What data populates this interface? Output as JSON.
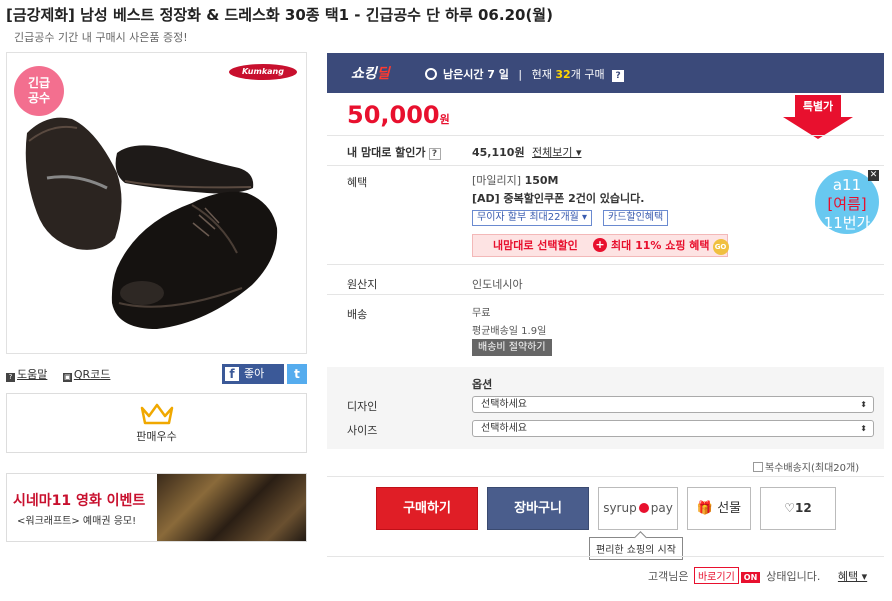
{
  "header": {
    "title": "[금강제화] 남성 베스트 정장화 & 드레스화 30종 택1 - 긴급공수 단 하루 06.20(월)",
    "subtitle": "긴급공수 기간 내 구매시 사은품 증정!"
  },
  "left": {
    "badge": [
      "긴급",
      "공수"
    ],
    "brand": "Kumkang",
    "help_link": "도움말",
    "qr_link": "QR코드",
    "facebook_label": "좋아",
    "facebook_f": "f",
    "twitter_label": "t",
    "seller_label": "판매우수",
    "banner": {
      "title": "시네마11 영화 이벤트",
      "subtitle": "<워크래프트> 예매권 응모!"
    }
  },
  "deal": {
    "logo_main": "쇼킹",
    "logo_accent": "딜",
    "time_label": "남은시간 7 일",
    "count_prefix": "현재",
    "count_value": "32",
    "count_suffix": "개 구매",
    "help": "?"
  },
  "price": {
    "amount": "50,000",
    "unit": "원",
    "special_label": "특별가"
  },
  "my_price": {
    "label": "내 맘대로 할인가",
    "help": "?",
    "value": "45,110원",
    "view_all": "전체보기 ▾"
  },
  "benefit": {
    "label": "혜택",
    "mileage_prefix": "[마일리지]",
    "mileage_value": "150M",
    "coupon": "[AD] 중복할인쿠폰 2건이 있습니다.",
    "chip_installment": "무이자 할부 최대22개월 ▾",
    "chip_card": "카드할인혜택",
    "discount_left": "내맘대로 선택할인",
    "discount_plus": "+",
    "discount_right": "최대 11% 쇼핑 혜택",
    "discount_go": "GO",
    "promo": [
      "a11",
      "[여름]",
      "11번가"
    ],
    "promo_close": "✕"
  },
  "origin": {
    "label": "원산지",
    "value": "인도네시아"
  },
  "shipping": {
    "label": "배송",
    "fee": "무료",
    "avg_days": "평균배송일 1.9일",
    "save_button": "배송비 절약하기"
  },
  "options": {
    "title": "옵션",
    "design_label": "디자인",
    "design_value": "선택하세요",
    "size_label": "사이즈",
    "size_value": "선택하세요",
    "arrow": "⬍"
  },
  "multi_ship": "복수배송지(최대20개)",
  "buttons": {
    "buy": "구매하기",
    "cart": "장바구니",
    "syrup_left": "syrup",
    "syrup_right": "pay",
    "gift": "선물",
    "gift_icon": "🎁",
    "like_icon": "♡",
    "like_count": "12"
  },
  "tooltip": "편리한 쇼핑의 시작",
  "footer": {
    "prefix": "고객님은",
    "shortcut": "바로기기",
    "on": "ON",
    "suffix": "상태입니다.",
    "benefit": "혜택 ▾"
  },
  "colors": {
    "accent_red": "#e8102e",
    "deal_bar": "#3b4a7a",
    "cart_blue": "#4a5d8c"
  }
}
